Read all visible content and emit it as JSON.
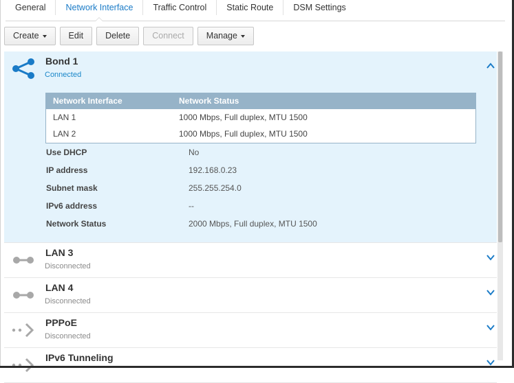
{
  "tabs": [
    {
      "label": "General"
    },
    {
      "label": "Network Interface"
    },
    {
      "label": "Traffic Control"
    },
    {
      "label": "Static Route"
    },
    {
      "label": "DSM Settings"
    }
  ],
  "toolbar": {
    "create": "Create",
    "edit": "Edit",
    "delete": "Delete",
    "connect": "Connect",
    "manage": "Manage"
  },
  "interfaces": [
    {
      "title": "Bond 1",
      "status": "Connected",
      "icon": "share-network-icon",
      "table": {
        "headers": [
          "Network Interface",
          "Network Status"
        ],
        "rows": [
          [
            "LAN 1",
            "1000 Mbps, Full duplex, MTU 1500"
          ],
          [
            "LAN 2",
            "1000 Mbps, Full duplex, MTU 1500"
          ]
        ]
      },
      "props": [
        {
          "label": "Use DHCP",
          "value": "No"
        },
        {
          "label": "IP address",
          "value": "192.168.0.23"
        },
        {
          "label": "Subnet mask",
          "value": "255.255.254.0"
        },
        {
          "label": "IPv6 address",
          "value": "--"
        },
        {
          "label": "Network Status",
          "value": "2000 Mbps, Full duplex, MTU 1500"
        }
      ]
    },
    {
      "title": "LAN 3",
      "status": "Disconnected",
      "icon": "ethernet-icon"
    },
    {
      "title": "LAN 4",
      "status": "Disconnected",
      "icon": "ethernet-icon"
    },
    {
      "title": "PPPoE",
      "status": "Disconnected",
      "icon": "pppoe-arrow-icon"
    },
    {
      "title": "IPv6 Tunneling",
      "status": "",
      "icon": "tunnel-arrow-icon"
    }
  ],
  "colors": {
    "accent": "#1a7bc7",
    "expanded_bg": "#e4f3fc",
    "table_header": "#96b3c8"
  }
}
